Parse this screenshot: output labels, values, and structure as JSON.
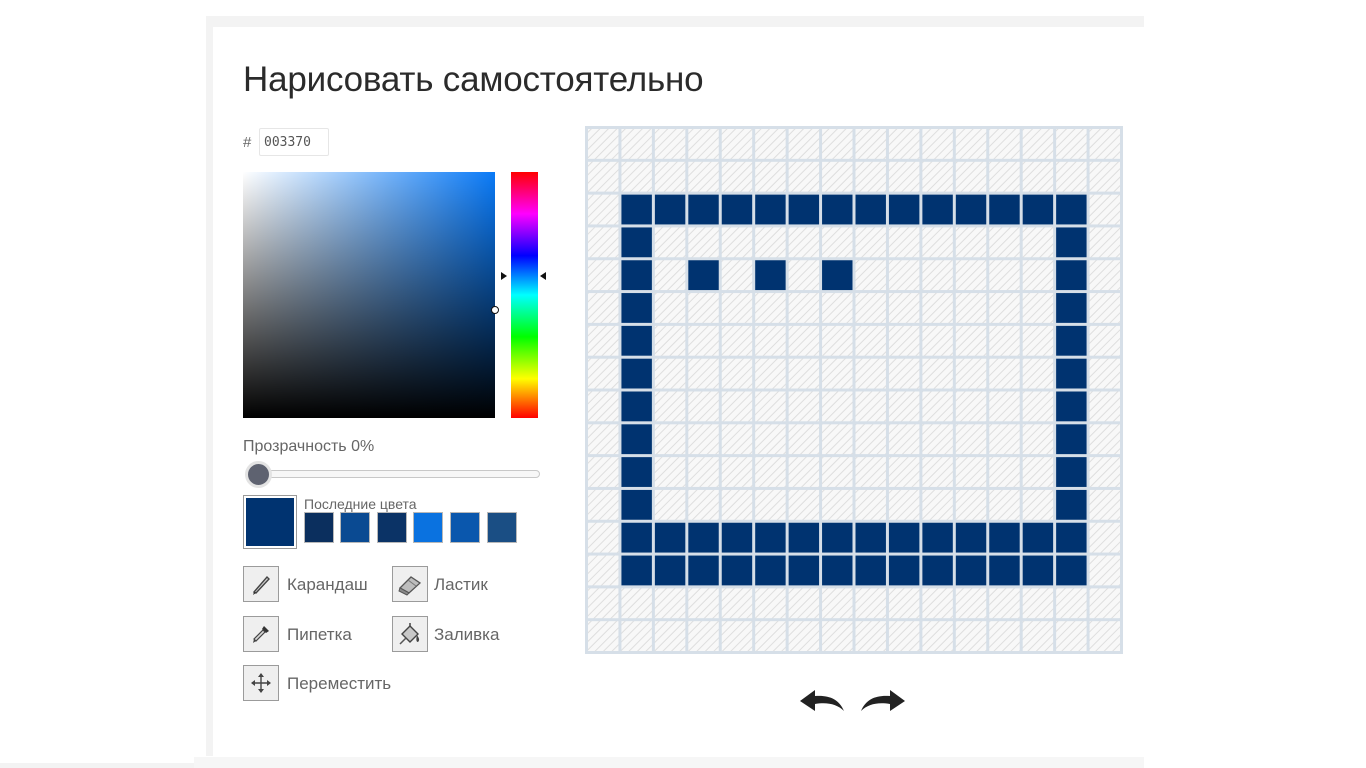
{
  "title": "Нарисовать самостоятельно",
  "color_picker": {
    "hash": "#",
    "hex_value": "003370",
    "hue_color": "#0a7af7",
    "current_color": "#003370"
  },
  "opacity": {
    "label": "Прозрачность 0%",
    "value_percent": 0
  },
  "recent": {
    "label": "Последние цвета",
    "colors": [
      "#0b2f5e",
      "#0a4a92",
      "#0b3366",
      "#0a72e0",
      "#0a57ad",
      "#1a4e84"
    ]
  },
  "tools": {
    "pencil": {
      "label": "Карандаш",
      "icon": "pencil-icon"
    },
    "eraser": {
      "label": "Ластик",
      "icon": "eraser-icon"
    },
    "pipette": {
      "label": "Пипетка",
      "icon": "pipette-icon"
    },
    "fill": {
      "label": "Заливка",
      "icon": "bucket-icon"
    },
    "move": {
      "label": "Переместить",
      "icon": "move-icon"
    }
  },
  "canvas": {
    "columns": 16,
    "rows": 16,
    "paint_color": "#003370",
    "filled": [
      "................",
      "................",
      ".##############.",
      ".#............#.",
      ".#.#.#.#......#.",
      ".#............#.",
      ".#............#.",
      ".#............#.",
      ".#............#.",
      ".#............#.",
      ".#............#.",
      ".#............#.",
      ".##############.",
      ".##############.",
      "................",
      "................"
    ]
  },
  "history": {
    "undo_icon": "undo-arrow-icon",
    "redo_icon": "redo-arrow-icon"
  }
}
